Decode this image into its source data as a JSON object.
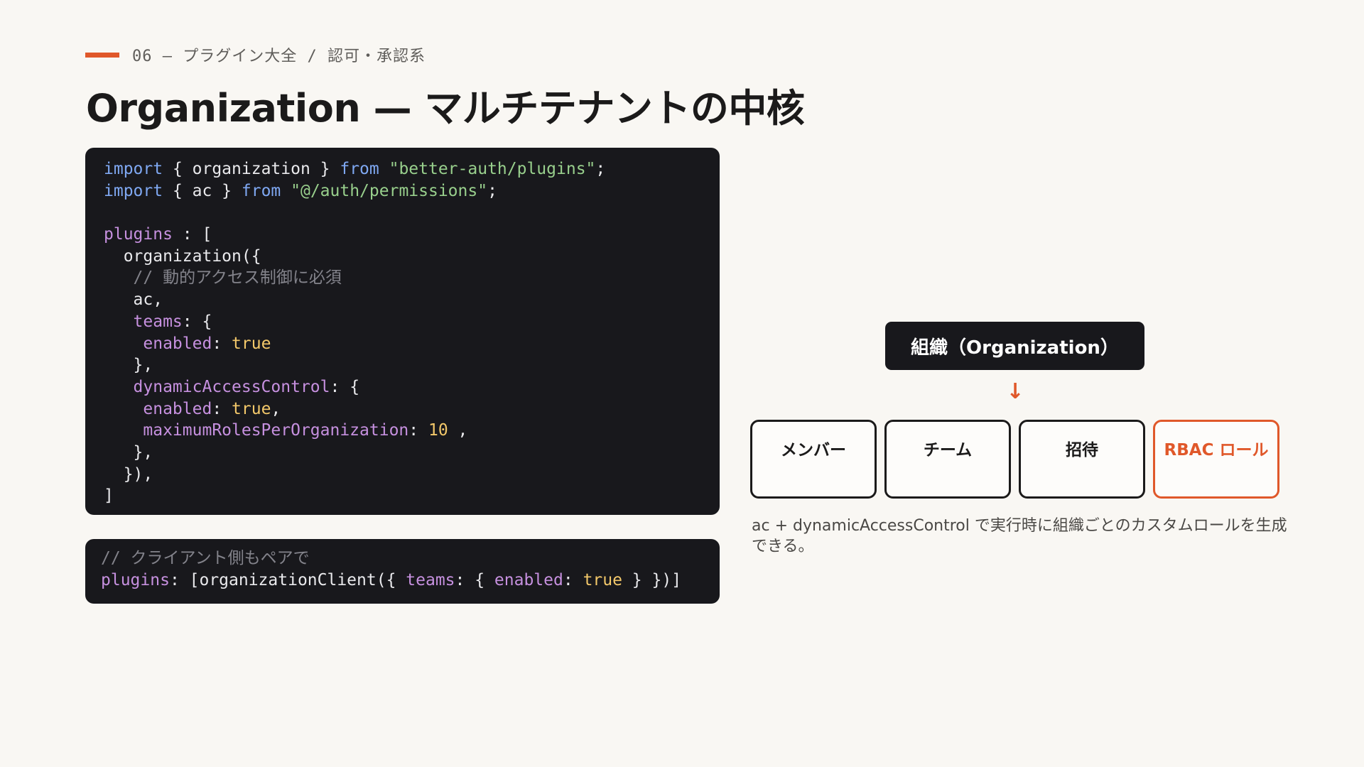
{
  "header": {
    "eyebrow": "06 — プラグイン大全 / 認可・承認系",
    "title": "Organization — マルチテナントの中核"
  },
  "code_main": {
    "l1": [
      "import",
      " { organization } ",
      "from",
      " ",
      "\"better-auth/plugins\"",
      ";"
    ],
    "l2": [
      "import",
      " { ac } ",
      "from",
      " ",
      "\"@/auth/permissions\"",
      ";"
    ],
    "l4": [
      "plugins",
      " : ["
    ],
    "l5": "  organization({",
    "l6": "   // 動的アクセス制御に必須",
    "l7": "   ac,",
    "l8": [
      "   ",
      "teams",
      ": {"
    ],
    "l9": [
      "    ",
      "enabled",
      ": ",
      "true"
    ],
    "l10": "   },",
    "l11": [
      "   ",
      "dynamicAccessControl",
      ": {"
    ],
    "l12": [
      "    ",
      "enabled",
      ": ",
      "true",
      ","
    ],
    "l13": [
      "    ",
      "maximumRolesPerOrganization",
      ": ",
      "10",
      " ,"
    ],
    "l14": "   },",
    "l15": "  }),",
    "l16": "]"
  },
  "code_client": {
    "l1": "// クライアント側もペアで",
    "l2": [
      "plugins",
      ": [organizationClient({ ",
      "teams",
      ": { ",
      "enabled",
      ": ",
      "true",
      " } })]"
    ]
  },
  "diagram": {
    "parent": "組織（Organization）",
    "arrow": "↓",
    "children": [
      "メンバー",
      "チーム",
      "招待",
      "RBAC ロール"
    ]
  },
  "caption": "ac + dynamicAccessControl で実行時に組織ごとのカスタムロールを生成できる。",
  "colors": {
    "accent": "#e0582a",
    "background": "#f9f7f3",
    "code_bg": "#18181c"
  }
}
